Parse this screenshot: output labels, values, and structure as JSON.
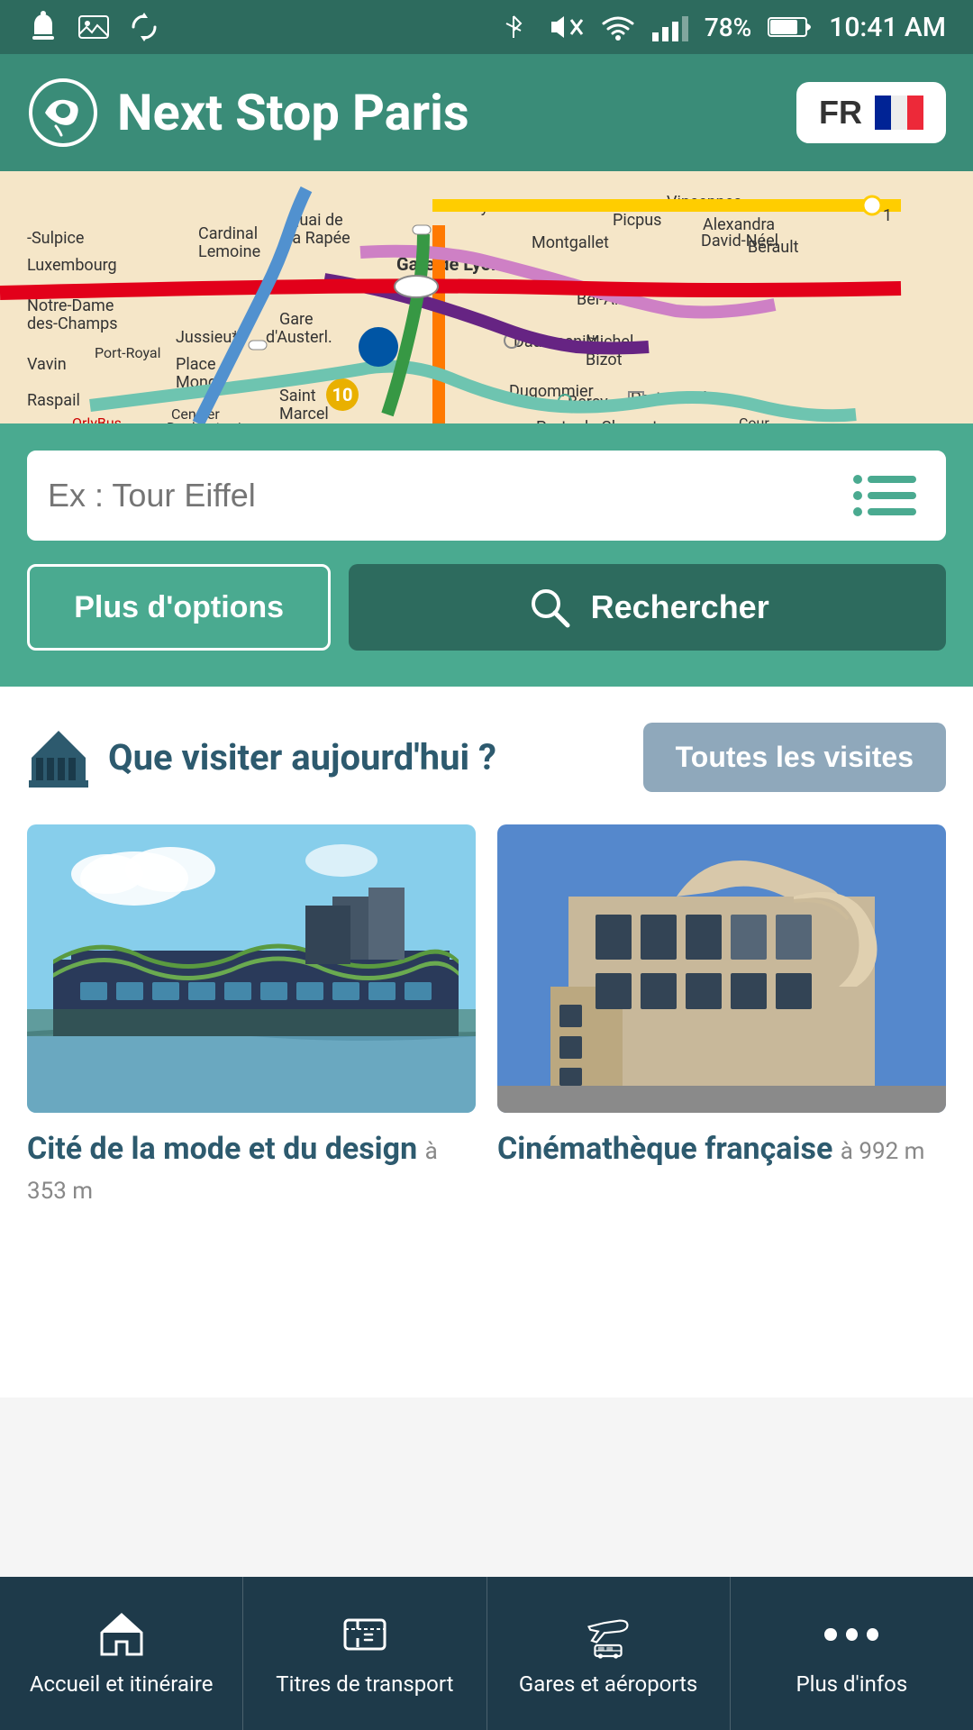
{
  "statusBar": {
    "time": "10:41 AM",
    "battery": "78%",
    "icons": [
      "notification",
      "image",
      "sync",
      "bluetooth-mute",
      "sound-off",
      "wifi",
      "signal"
    ]
  },
  "header": {
    "title": "Next Stop Paris",
    "langCode": "FR",
    "logoAlt": "Next Stop Paris logo"
  },
  "map": {
    "alt": "Paris Metro Map"
  },
  "search": {
    "placeholder": "Ex : Tour Eiffel",
    "optionsLabel": "Plus d'options",
    "searchLabel": "Rechercher"
  },
  "visitSection": {
    "title": "Que visiter aujourd'hui ?",
    "allVisitsLabel": "Toutes les visites",
    "cards": [
      {
        "title": "Cité de la mode et du design",
        "distance": "à 353 m",
        "imageColor1": "#87CEEB",
        "imageColor2": "#4a7a3a"
      },
      {
        "title": "Cinémathèque française",
        "distance": "à 992 m",
        "imageColor1": "#87CEEB",
        "imageColor2": "#c8b89a"
      }
    ]
  },
  "bottomNav": {
    "items": [
      {
        "label": "Accueil et itinéraire",
        "icon": "home"
      },
      {
        "label": "Titres de transport",
        "icon": "ticket"
      },
      {
        "label": "Gares et aéroports",
        "icon": "plane-train"
      },
      {
        "label": "Plus d'infos",
        "icon": "more"
      }
    ]
  }
}
